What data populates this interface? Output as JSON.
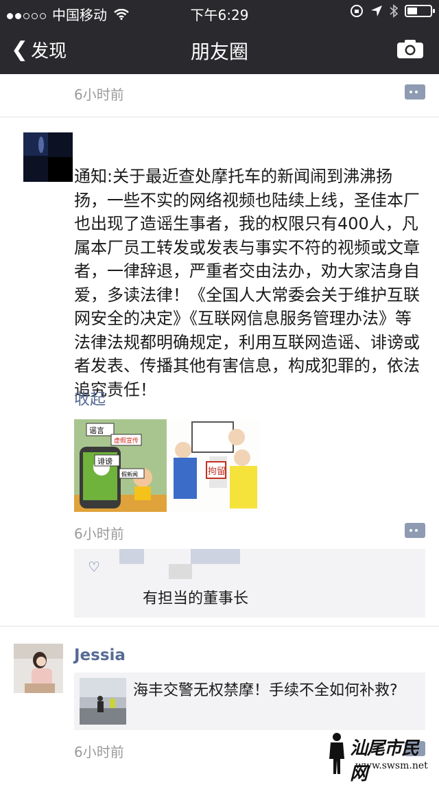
{
  "status_bar": {
    "carrier": "中国移动",
    "time": "下午6:29",
    "battery_level": 0.45,
    "signal_dots_filled": 2,
    "signal_dots_total": 5
  },
  "nav": {
    "back_label": "发现",
    "title": "朋友圈",
    "camera_icon": "camera-icon"
  },
  "prev_post": {
    "time": "6小时前"
  },
  "post": {
    "text": "通知:关于最近查处摩托车的新闻闹到沸沸扬扬，一些不实的网络视频也陆续上线，圣佳本厂也出现了造谣生事者，我的权限只有400人，凡属本厂员工转发或发表与事实不符的视频或文章者，一律辞退，严重者交由法办，劝大家洁身自爱，多读法律！《全国人大常委会关于维护互联网安全的决定》《互联网信息服务管理办法》等法律法规都明确规定，利用互联网造谣、诽谤或者发表、传播其他有害信息，构成犯罪的，依法追究责任！",
    "collapse_label": "收起",
    "images": [
      {
        "words": [
          "谣言",
          "虚假宣传",
          "诽谤",
          "假新闻"
        ]
      },
      {
        "words": [
          "拘留"
        ]
      }
    ],
    "time": "6小时前",
    "comment": "有担当的董事长"
  },
  "next_post": {
    "author": "Jessia",
    "share_title": "海丰交警无权禁摩！手续不全如何补救?",
    "time": "6小时前"
  },
  "watermark": {
    "text": "汕尾市民网",
    "url": "www.swsm.net"
  },
  "colors": {
    "nav_bg": "#2a2a2e",
    "link": "#576b95",
    "comment_bg": "#f3f3f5"
  }
}
